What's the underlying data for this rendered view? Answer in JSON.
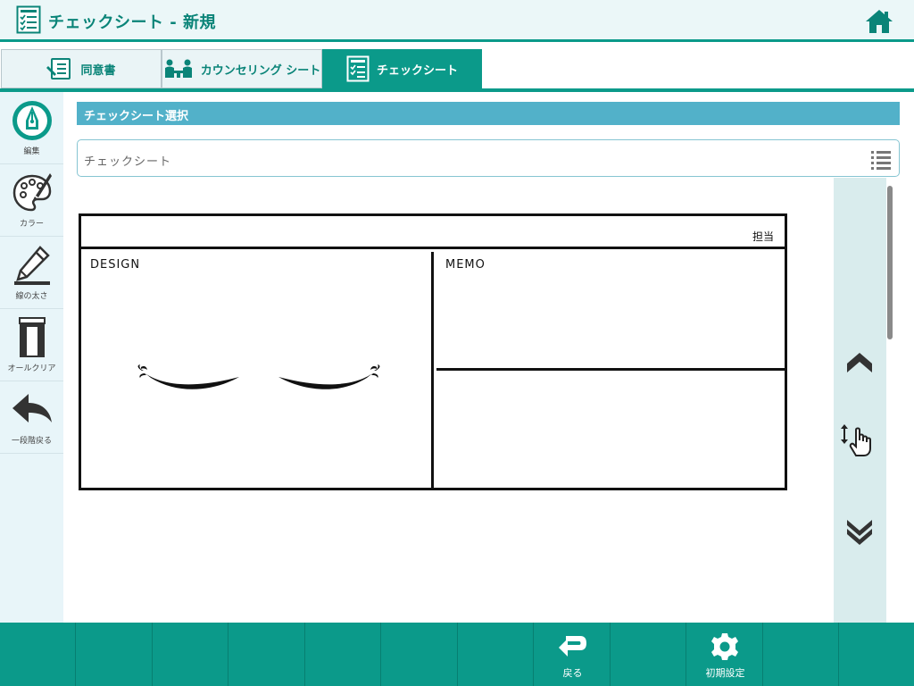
{
  "header": {
    "title": "チェックシート - 新規",
    "app_icon": "checklist-icon",
    "home_icon": "home-icon"
  },
  "tabs": [
    {
      "label": "同意書",
      "icon": "consent-form-icon",
      "active": false
    },
    {
      "label": "カウンセリング シート",
      "icon": "counseling-icon",
      "active": false
    },
    {
      "label": "チェックシート",
      "icon": "checklist-icon",
      "active": true
    }
  ],
  "tools": [
    {
      "label": "編集",
      "icon": "pen-edit-icon"
    },
    {
      "label": "カラー",
      "icon": "palette-icon"
    },
    {
      "label": "線の太さ",
      "icon": "line-width-icon"
    },
    {
      "label": "オールクリア",
      "icon": "all-clear-icon"
    },
    {
      "label": "一段階戻る",
      "icon": "undo-icon"
    }
  ],
  "main": {
    "section_title": "チェックシート選択",
    "select_placeholder": "チェックシート",
    "sheet": {
      "tanto_label": "担当",
      "design_label": "DESIGN",
      "memo_label": "MEMO"
    }
  },
  "scroll_controls": [
    "scroll-up-icon",
    "drag-hand-icon",
    "scroll-down-icon"
  ],
  "bottom_bar": {
    "back_label": "戻る",
    "settings_label": "初期設定"
  },
  "colors": {
    "accent": "#0b9a8a",
    "section_bar": "#52b1c9",
    "sidebar_bg": "#e8f5f9",
    "scroll_panel_bg": "#d9eced"
  }
}
